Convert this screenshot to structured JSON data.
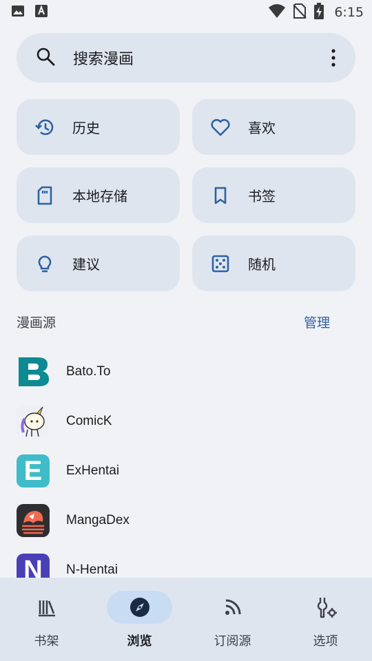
{
  "status_bar": {
    "time": "6:15",
    "icons": [
      "image-icon",
      "a-keyboard-icon",
      "wifi-icon",
      "no-sim-icon",
      "battery-charging-icon"
    ]
  },
  "search": {
    "placeholder": "搜索漫画",
    "icon": "search-icon",
    "menu_icon": "more-vert-icon"
  },
  "tiles": [
    {
      "label": "历史",
      "icon": "history-icon"
    },
    {
      "label": "喜欢",
      "icon": "heart-icon"
    },
    {
      "label": "本地存储",
      "icon": "sd-card-icon"
    },
    {
      "label": "书签",
      "icon": "bookmark-icon"
    },
    {
      "label": "建议",
      "icon": "lightbulb-icon"
    },
    {
      "label": "随机",
      "icon": "dice-icon"
    }
  ],
  "sources_section": {
    "title": "漫画源",
    "manage_label": "管理"
  },
  "sources": [
    {
      "name": "Bato.To",
      "logo_letter": "B",
      "color": "#0e8a92"
    },
    {
      "name": "ComicK",
      "logo_letter": "",
      "color": "#eef0f6"
    },
    {
      "name": "ExHentai",
      "logo_letter": "E",
      "color": "#3fbcc8"
    },
    {
      "name": "MangaDex",
      "logo_letter": "",
      "color": "#2e2e31"
    },
    {
      "name": "N-Hentai",
      "logo_letter": "N",
      "color": "#4b3fb8"
    }
  ],
  "bottom_nav": [
    {
      "label": "书架",
      "icon": "library-icon",
      "active": false
    },
    {
      "label": "浏览",
      "icon": "compass-icon",
      "active": true
    },
    {
      "label": "订阅源",
      "icon": "rss-icon",
      "active": false
    },
    {
      "label": "选项",
      "icon": "settings-tools-icon",
      "active": false
    }
  ],
  "colors": {
    "accent": "#2d62a3",
    "surface": "#dfe5ef",
    "background": "#f1f2f6",
    "active_pill": "#c8dcf4"
  }
}
